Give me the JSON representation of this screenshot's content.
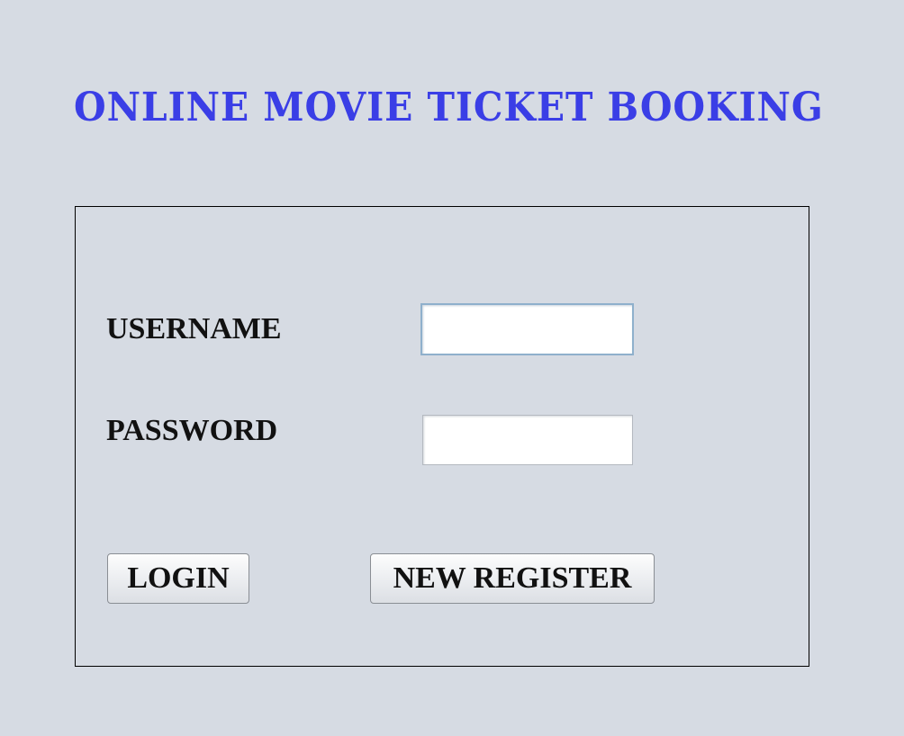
{
  "app": {
    "title": "ONLINE MOVIE TICKET BOOKING",
    "title_color": "#3a3ee6",
    "background_color": "#d6dbe3"
  },
  "form": {
    "username_label": "USERNAME",
    "username_value": "",
    "password_label": "PASSWORD",
    "password_value": "",
    "login_label": "LOGIN",
    "register_label": "NEW REGISTER"
  }
}
